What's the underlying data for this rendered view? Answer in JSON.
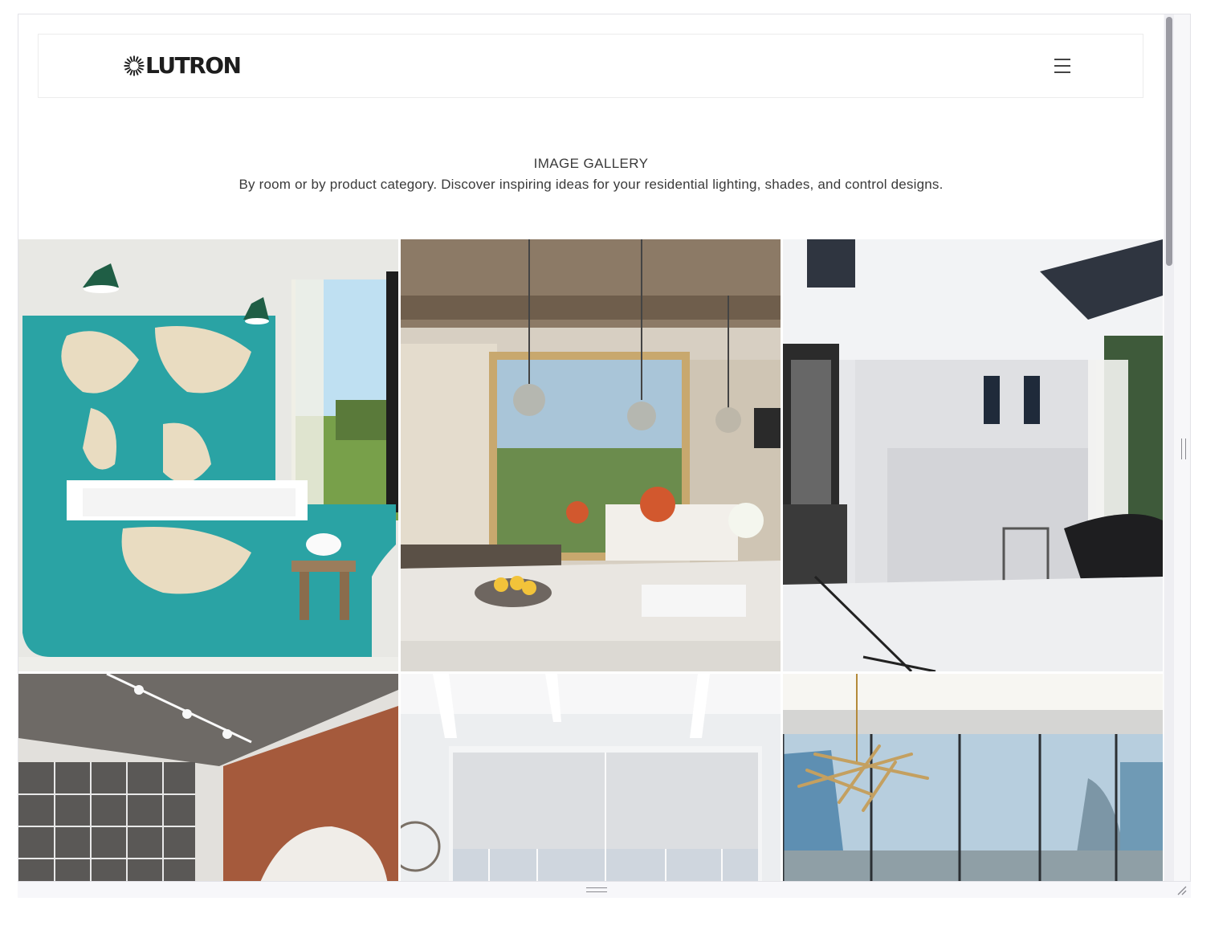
{
  "header": {
    "logo_text": "LUTRON",
    "menu_icon": "hamburger-menu-icon"
  },
  "intro": {
    "title": "IMAGE GALLERY",
    "subtitle": "By room or by product category. Discover inspiring ideas for your residential lighting, shades, and control designs."
  },
  "gallery": {
    "tiles": [
      {
        "subject": "bathroom-world-map-mosaic-tub"
      },
      {
        "subject": "kitchen-living-room-pendants"
      },
      {
        "subject": "marble-bathroom-clawfoot-tub"
      },
      {
        "subject": "loft-brick-wall-track-lighting"
      },
      {
        "subject": "white-room-roller-shades"
      },
      {
        "subject": "highrise-living-room-chandelier"
      }
    ]
  },
  "colors": {
    "logo": "#1d1d1d",
    "text": "#3a3a3a",
    "header_border": "#ececec"
  }
}
